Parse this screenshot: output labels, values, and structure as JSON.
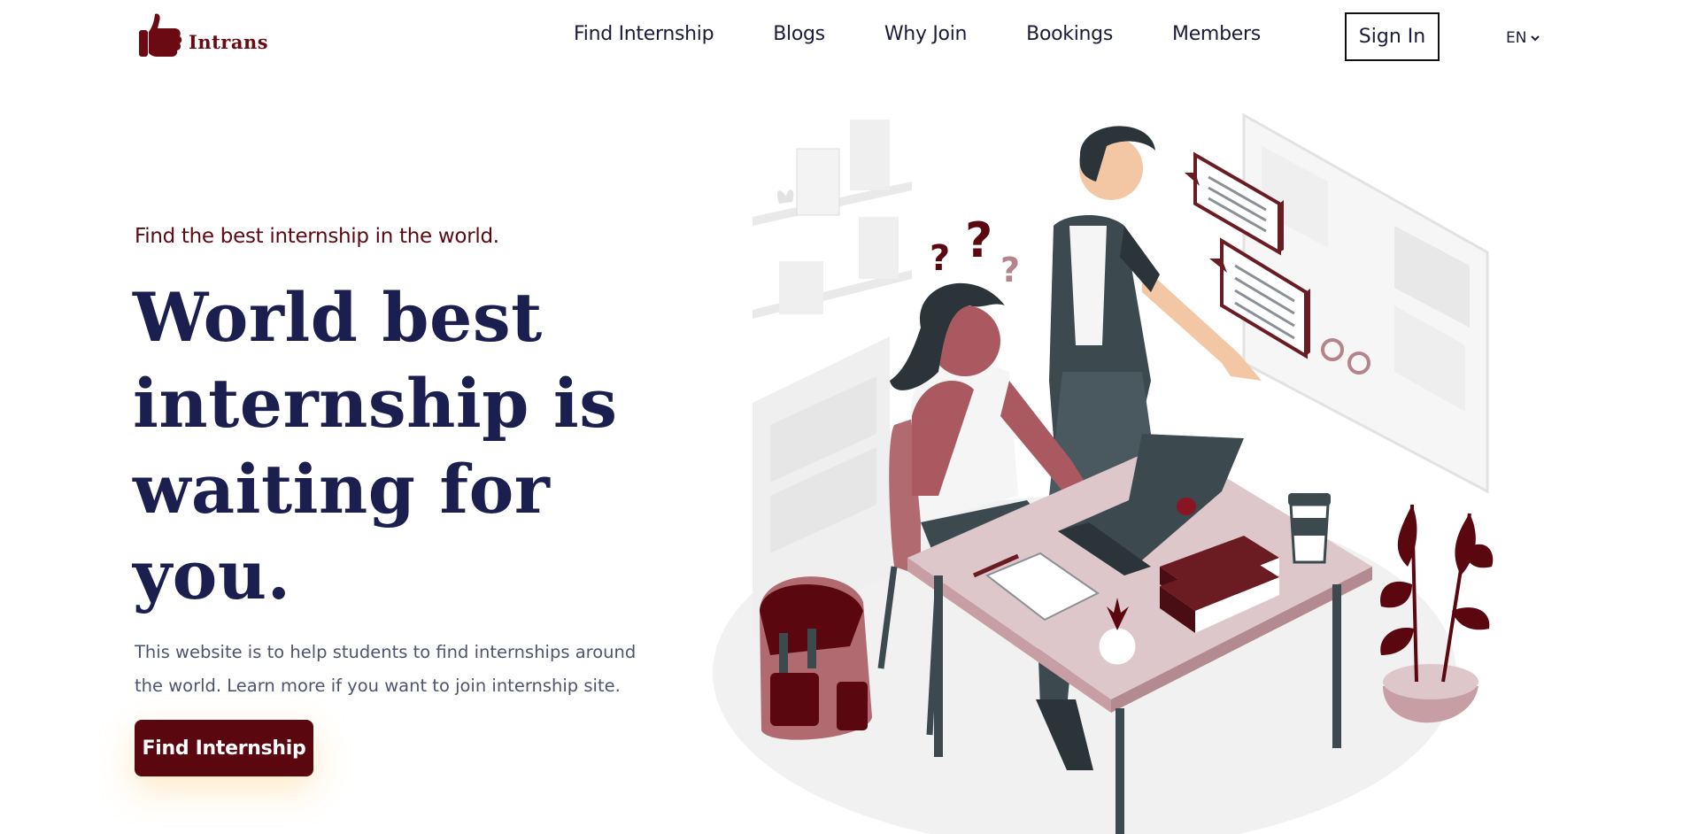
{
  "brand": {
    "name": "Intrans",
    "logo_icon": "thumbs-up-icon",
    "color": "#6b0a12"
  },
  "nav": {
    "items": [
      "Find Internship",
      "Blogs",
      "Why Join",
      "Bookings",
      "Members"
    ],
    "signin_label": "Sign In",
    "language": "EN",
    "language_icon": "chevron-down-icon"
  },
  "hero": {
    "eyebrow": "Find the best internship in the world.",
    "headline": "World best internship is waiting for you.",
    "description": "This website is to help students to find internships around the world. Learn more if you want to join internship site.",
    "cta_label": "Find Internship",
    "illustration_icon": "office-illustration-icon"
  },
  "colors": {
    "accent": "#5a0710",
    "heading": "#1b1f4f",
    "body_text": "#4e5470"
  }
}
